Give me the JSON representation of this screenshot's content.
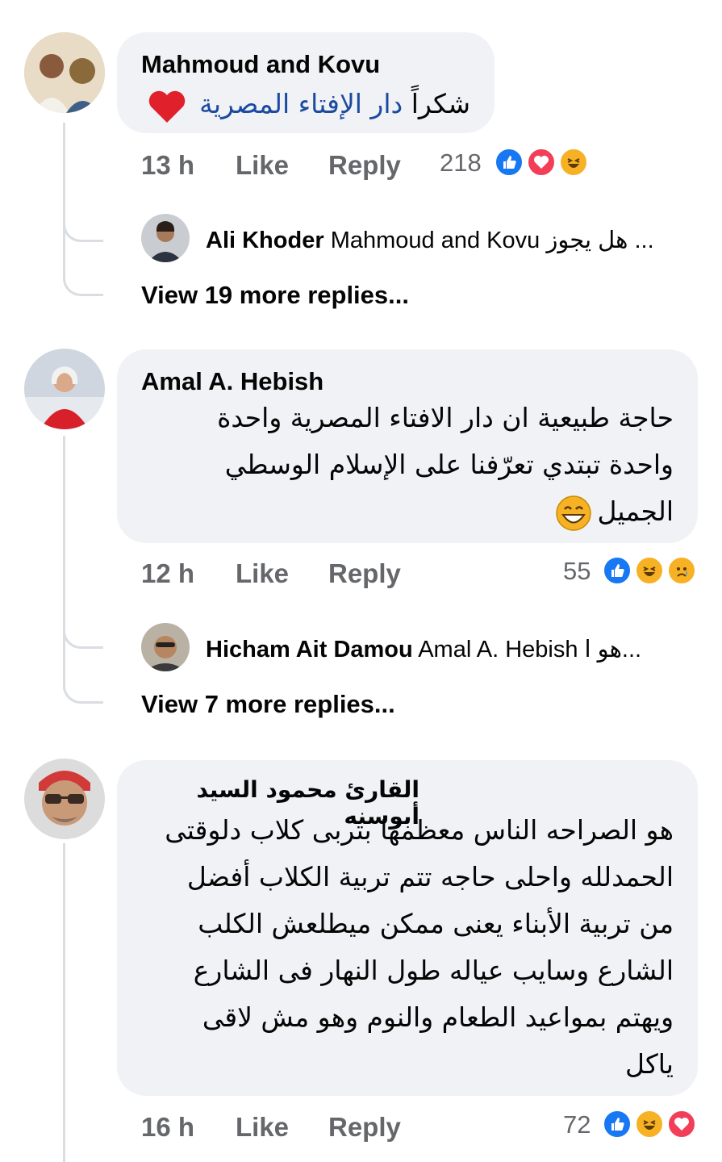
{
  "comments": [
    {
      "author": "Mahmoud and Kovu",
      "text": "شكراً",
      "link_text": "دار الإفتاء المصرية",
      "time": "13 h",
      "like": "Like",
      "reply": "Reply",
      "reaction_count": "218",
      "reply_preview": {
        "author": "Ali Khoder",
        "mention": "Mahmoud and Kovu",
        "text": "... هل يجوز"
      },
      "view_more": "View 19 more replies..."
    },
    {
      "author": "Amal A. Hebish",
      "lines": [
        "حاجة طبيعية ان دار الافتاء المصرية واحدة",
        "واحدة تبتدي تعرّفنا على الإسلام الوسطي",
        "الجميل"
      ],
      "time": "12 h",
      "like": "Like",
      "reply": "Reply",
      "reaction_count": "55",
      "reply_preview": {
        "author": "Hicham Ait Damou",
        "mention": "Amal A. Hebish",
        "text": "...هو ا"
      },
      "view_more": "View 7 more replies..."
    },
    {
      "author": "القارئ محمود السيد أبوسنه",
      "lines": [
        "هو الصراحه الناس معظمها بتربى كلاب دلوقتى",
        "الحمدلله واحلى حاجه تتم تربية الكلاب أفضل",
        "من تربية الأبناء يعنى ممكن ميطلعش الكلب",
        "الشارع وسايب عياله طول النهار فى الشارع",
        "ويهتم بمواعيد الطعام والنوم وهو مش لاقى",
        "ياكل"
      ],
      "time": "16 h",
      "like": "Like",
      "reply": "Reply",
      "reaction_count": "72"
    }
  ],
  "colors": {
    "bubble": "#f0f2f5",
    "meta": "#65676b",
    "link": "#1b4aa0",
    "like": "#1877f2",
    "love": "#f33e58",
    "haha": "#f7b125"
  }
}
